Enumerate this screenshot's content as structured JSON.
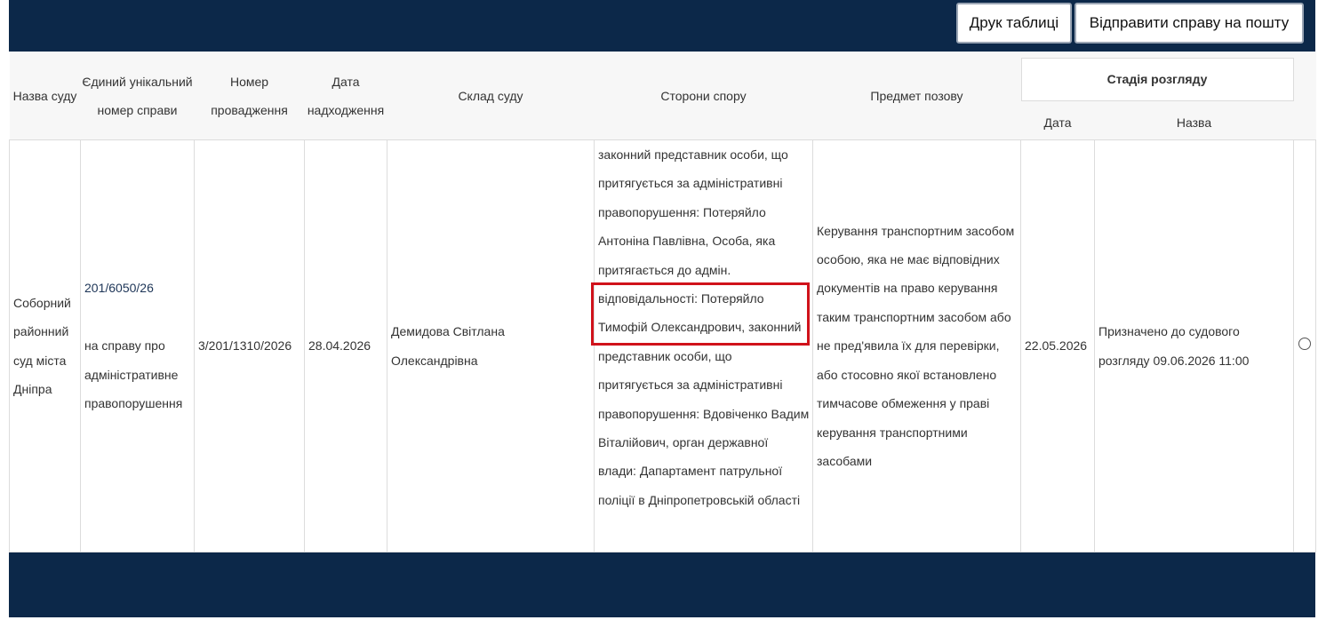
{
  "toolbar": {
    "print_label": "Друк таблиці",
    "email_label": "Відправити справу на пошту"
  },
  "table": {
    "headers": {
      "court": "Назва суду",
      "case_number": "Єдиний унікальний номер справи",
      "proceeding_number": "Номер провадження",
      "received_date": "Дата надходження",
      "composition": "Склад суду",
      "parties": "Сторони спору",
      "subject": "Предмет позову",
      "stage": "Стадія розгляду",
      "stage_date": "Дата",
      "stage_name": "Назва"
    },
    "row": {
      "court": "Соборний районний суд міста Дніпра",
      "case_number": "201/6050/26",
      "case_type": "на справу про адміністративне правопорушення",
      "proceeding_number": "3/201/1310/2026",
      "received_date": "28.04.2026",
      "composition": "Демидова Світлана Олександрівна",
      "parties_before": "законний представник особи, що притягується за адміністративні правопорушення: Потеряйло Антоніна Павлівна, Особа, яка притягається до адмін.",
      "parties_highlighted": "відповідальності: Потеряйло Тимофій Олександрович,",
      "parties_after": "законний представник особи, що притягується за адміністративні правопорушення: Вдовіченко Вадим Віталійович, орган державної влади: Дапартамент патрульної поліції в Дніпропетровській області",
      "subject": "Керування транспортним засобом особою, яка не має відповідних документів на право керування таким транспортним засобом або не пред'явила їх для перевірки, або стосовно якої встановлено тимчасове обмеження у праві керування транспортними засобами",
      "stage_date": "22.05.2026",
      "stage_name": "Призначено до судового розгляду 09.06.2026 11:00"
    }
  },
  "colors": {
    "navy_bar": "#0c2849",
    "highlight_border": "#d0121b"
  }
}
